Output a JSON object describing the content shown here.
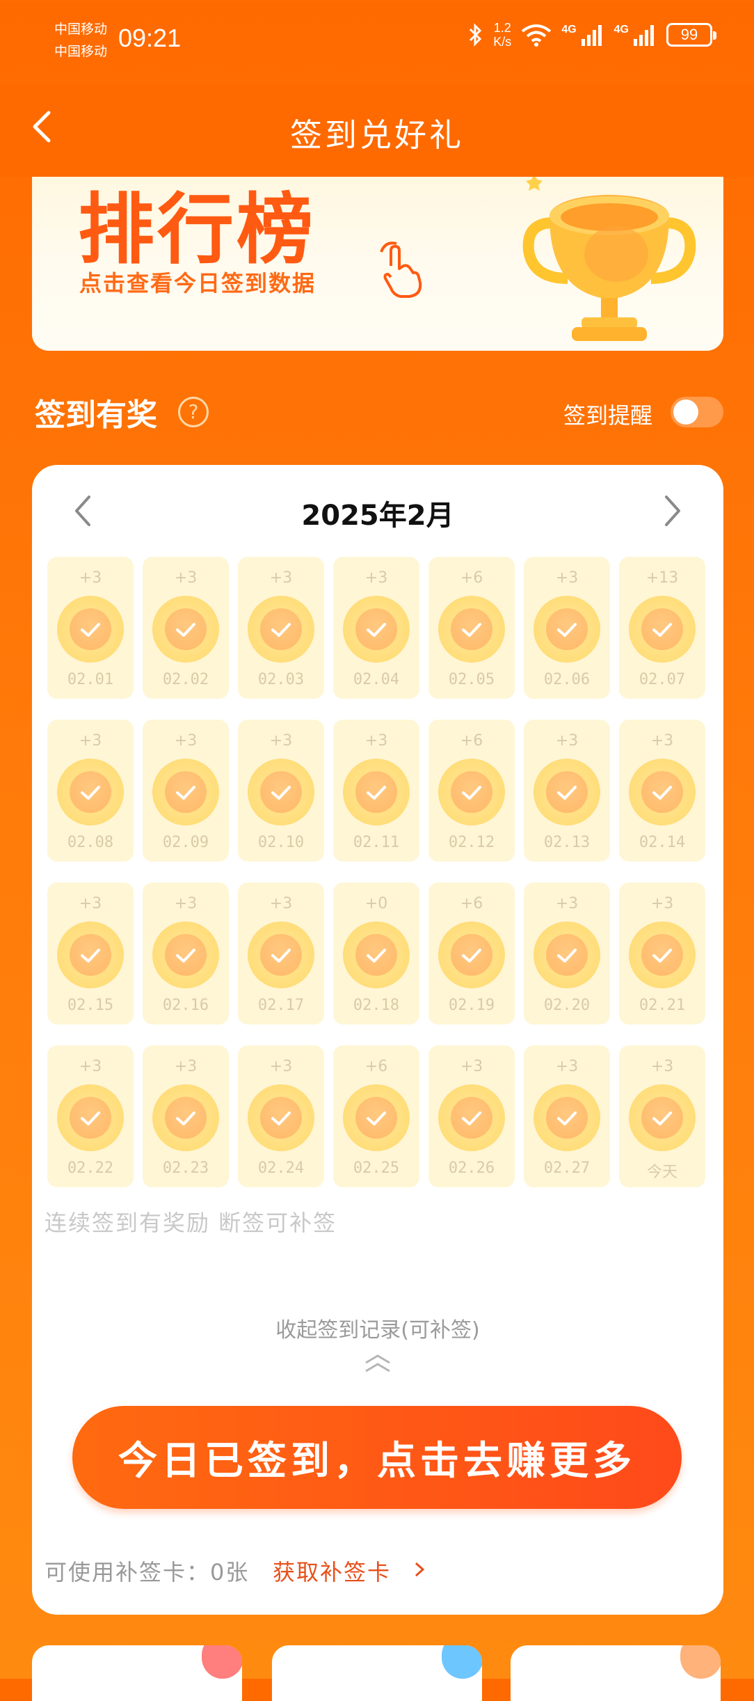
{
  "status_bar": {
    "carrier_1": "中国移动",
    "carrier_2": "中国移动",
    "time": "09:21",
    "speed_value": "1.2",
    "speed_unit": "K/s",
    "network_1": "4G",
    "network_2": "4G",
    "battery": "99"
  },
  "header": {
    "title": "签到兑好礼"
  },
  "banner": {
    "title": "排行榜",
    "subtitle": "点击查看今日签到数据"
  },
  "section": {
    "title": "签到有奖",
    "help": "?",
    "reminder_label": "签到提醒",
    "reminder_on": false
  },
  "calendar": {
    "month": "2025年2月",
    "days": [
      {
        "points": "+3",
        "label": "02.01"
      },
      {
        "points": "+3",
        "label": "02.02"
      },
      {
        "points": "+3",
        "label": "02.03"
      },
      {
        "points": "+3",
        "label": "02.04"
      },
      {
        "points": "+6",
        "label": "02.05"
      },
      {
        "points": "+3",
        "label": "02.06"
      },
      {
        "points": "+13",
        "label": "02.07"
      },
      {
        "points": "+3",
        "label": "02.08"
      },
      {
        "points": "+3",
        "label": "02.09"
      },
      {
        "points": "+3",
        "label": "02.10"
      },
      {
        "points": "+3",
        "label": "02.11"
      },
      {
        "points": "+6",
        "label": "02.12"
      },
      {
        "points": "+3",
        "label": "02.13"
      },
      {
        "points": "+3",
        "label": "02.14"
      },
      {
        "points": "+3",
        "label": "02.15"
      },
      {
        "points": "+3",
        "label": "02.16"
      },
      {
        "points": "+3",
        "label": "02.17"
      },
      {
        "points": "+0",
        "label": "02.18"
      },
      {
        "points": "+6",
        "label": "02.19"
      },
      {
        "points": "+3",
        "label": "02.20"
      },
      {
        "points": "+3",
        "label": "02.21"
      },
      {
        "points": "+3",
        "label": "02.22"
      },
      {
        "points": "+3",
        "label": "02.23"
      },
      {
        "points": "+3",
        "label": "02.24"
      },
      {
        "points": "+6",
        "label": "02.25"
      },
      {
        "points": "+3",
        "label": "02.26"
      },
      {
        "points": "+3",
        "label": "02.27"
      },
      {
        "points": "+3",
        "label": "今天"
      }
    ]
  },
  "note": "连续签到有奖励 断签可补签",
  "collapse_label": "收起签到记录(可补签)",
  "cta_label": "今日已签到，点击去赚更多",
  "makeup": {
    "available": "可使用补签卡：0张",
    "get_link": "获取补签卡"
  },
  "colors": {
    "brand": "#FF6A00",
    "cta": "#FF4A1A",
    "tile": "#FFF6D6",
    "link": "#E8501A"
  }
}
